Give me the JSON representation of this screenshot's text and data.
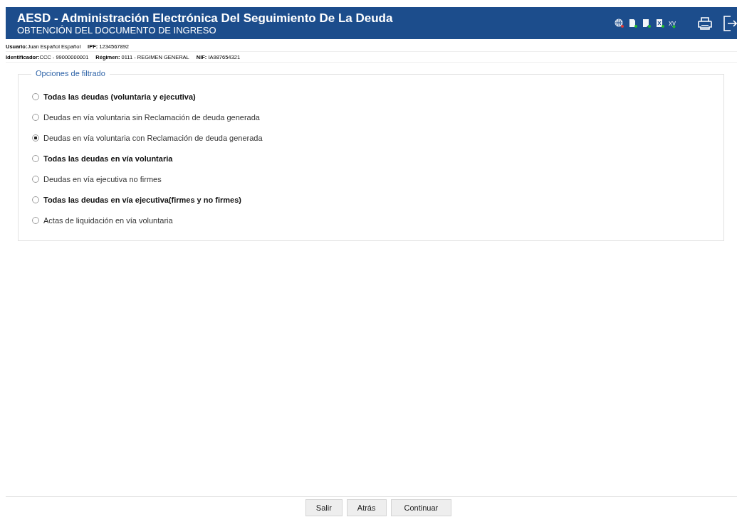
{
  "header": {
    "title": "AESD - Administración Electrónica Del Seguimiento De La Deuda",
    "subtitle": "OBTENCIÓN DEL DOCUMENTO DE INGRESO",
    "status_icons": [
      {
        "kind": "globe",
        "color": "#e53935"
      },
      {
        "kind": "page",
        "color": "#22c02a"
      },
      {
        "kind": "folded",
        "color": "#22c02a"
      },
      {
        "kind": "excel",
        "color": "#22c02a"
      },
      {
        "kind": "text",
        "label": "xy",
        "color": "#22c02a"
      }
    ]
  },
  "info_lines": [
    [
      "**Usuario:**Juan Español  Español",
      "**IPF:** 1234567892"
    ],
    [
      "**Identificador:**CCC - 99000000001",
      "**Régimen:** 0111 - REGIMEN GENERAL",
      "**NIF:** IA987654321"
    ]
  ],
  "filter": {
    "legend": "Opciones de filtrado",
    "options": [
      {
        "label": "Todas las deudas (voluntaria y ejecutiva)",
        "bold": true,
        "selected": false
      },
      {
        "label": "Deudas en vía voluntaria sin Reclamación de deuda generada",
        "bold": false,
        "selected": false
      },
      {
        "label": "Deudas en vía voluntaria con Reclamación de deuda generada",
        "bold": false,
        "selected": true
      },
      {
        "label": "Todas las deudas en vía voluntaria",
        "bold": true,
        "selected": false
      },
      {
        "label": "Deudas en vía ejecutiva no firmes",
        "bold": false,
        "selected": false
      },
      {
        "label": "Todas las deudas en vía ejecutiva(firmes y no firmes)",
        "bold": true,
        "selected": false
      },
      {
        "label": "Actas de liquidación en vía voluntaria",
        "bold": false,
        "selected": false
      }
    ]
  },
  "buttons": [
    "Salir",
    "Atrás",
    "Continuar"
  ]
}
